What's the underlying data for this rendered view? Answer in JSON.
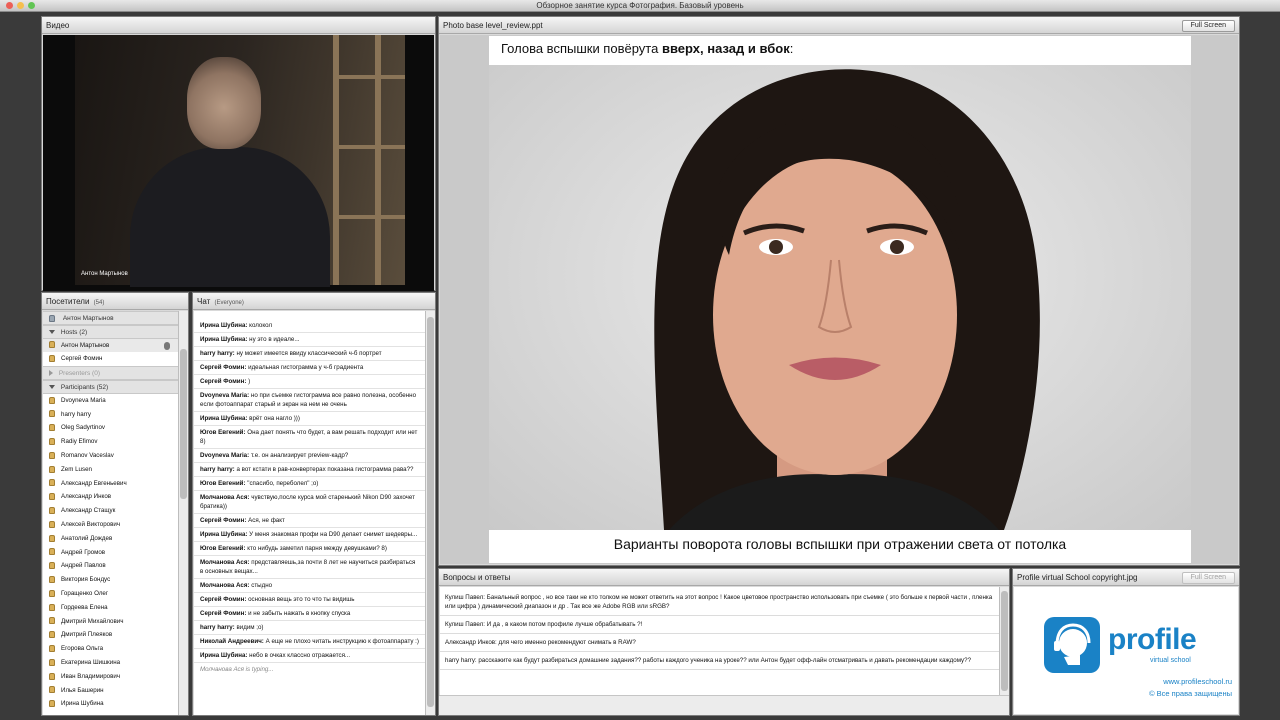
{
  "window": {
    "title": "Обзорное занятие курса Фотография. Базовый уровень"
  },
  "video": {
    "title": "Видео",
    "presenter_name": "Антон Мартынов"
  },
  "attendees": {
    "title": "Посетители",
    "count": "(54)",
    "top_user": "Антон Мартынов",
    "hosts_label": "Hosts (2)",
    "hosts": [
      "Антон Мартынов",
      "Сергей Фомин"
    ],
    "presenters_label": "Presenters (0)",
    "participants_label": "Participants (52)",
    "participants": [
      "Dvoyneva Maria",
      "harry harry",
      "Oleg Sadyrtinov",
      "Radiy Efimov",
      "Romanov Vaceslav",
      "Zem Lusen",
      "Александр Евгеньевич",
      "Александр Инков",
      "Александр Стащук",
      "Алексей Викторович",
      "Анатолий Дождев",
      "Андрей Громов",
      "Андрей Павлов",
      "Виктория Бондус",
      "Горащенко Олег",
      "Гордеева Елена",
      "Дмитрий Михайлович",
      "Дмитрий Плеяков",
      "Егорова Ольга",
      "Екатерина Шишкина",
      "Иван Владимирович",
      "Илья Башерин",
      "Ирина Шубина"
    ]
  },
  "chat": {
    "title": "Чат",
    "scope": "(Everyone)",
    "messages": [
      {
        "author": "Ирина Шубина:",
        "text": " колокол"
      },
      {
        "author": "Ирина Шубина:",
        "text": " ну это в идеале..."
      },
      {
        "author": "harry harry:",
        "text": " ну может имеется ввиду классический ч-б портрет"
      },
      {
        "author": "Сергей Фомин:",
        "text": " идеальная гистограмма у ч-б градиента"
      },
      {
        "author": "Сергей Фомин:",
        "text": " )"
      },
      {
        "author": "Dvoyneva Maria:",
        "text": " но при съемке гистограмма все равно полезна, особенно если фотоаппарат старый и экран на нем не очень"
      },
      {
        "author": "Ирина Шубина:",
        "text": " врёт она нагло )))"
      },
      {
        "author": "Югов Евгений:",
        "text": " Она дает понять что будет, а вам решать подходит или нет 8)"
      },
      {
        "author": "Dvoyneva Maria:",
        "text": " т.е. он анализирует preview-кадр?"
      },
      {
        "author": "harry harry:",
        "text": " а вот кстати в рав-конвертерах показана гистограмма рава??"
      },
      {
        "author": "Югов Евгений:",
        "text": " \"спасибо, переболел\" ;о)"
      },
      {
        "author": "Молчанова Ася:",
        "text": " чувствую,после курса мой старенький Nikon D90 захочет братика))"
      },
      {
        "author": "Сергей Фомин:",
        "text": " Ася, не факт"
      },
      {
        "author": "Ирина Шубина:",
        "text": " У меня знакомая профи на D90 делает снимет шедевры..."
      },
      {
        "author": "Югов Евгений:",
        "text": " кто нибудь заметил парня между девушками? 8)"
      },
      {
        "author": "Молчанова Ася:",
        "text": " представляешь,за почти 8 лет не научиться разбираться в основных вещах..."
      },
      {
        "author": "Молчанова Ася:",
        "text": " стыдно"
      },
      {
        "author": "Сергей Фомин:",
        "text": " основная вещь это то что ты видишь"
      },
      {
        "author": "Сергей Фомин:",
        "text": " и не забыть нажать в кнопку спуска"
      },
      {
        "author": "harry harry:",
        "text": " видим ;о)"
      },
      {
        "author": "Николай Андреевич:",
        "text": " А еще не плохо читать инструкцию к фотоаппарату :)"
      },
      {
        "author": "Ирина Шубина:",
        "text": " небо в очках классно отражается..."
      }
    ],
    "typing": "Молчанова Ася is typing..."
  },
  "slide": {
    "pod_title": "Photo base level_review.ppt",
    "fullscreen_label": "Full Screen",
    "top_text_normal": "Голова вспышки повёрута ",
    "top_text_bold": "вверх, назад и вбок",
    "top_text_end": ":",
    "bottom_text": "Варианты поворота головы вспышки при отражении света от потолка"
  },
  "qa": {
    "title": "Вопросы и ответы",
    "messages": [
      {
        "text": "Кулиш Павел: Банальный вопрос , но все таки не кто толком не может ответить на этот вопрос ! Какое цветовое пространство использовать при съемке ( это больше к первой части , пленка или цифра ) динамический диапазон и др . Так все же Adobe RGB или sRGB?"
      },
      {
        "text": "Кулиш Павел: И да , в каком потом профиле лучше обрабатывать ?!"
      },
      {
        "text": "Александр Инков: для чего именно рекомендуют снимать в RAW?"
      },
      {
        "text": "harry harry: расскажите как будут разбираться домашние задания?? работы каждого ученика на уроке?? или Антон будет офф-лайн отсматривать и давать рекомендации каждому??"
      }
    ]
  },
  "logo_pod": {
    "title": "Profile virtual School copyright.jpg",
    "fullscreen_label": "Full Screen",
    "brand": "profile",
    "brand_sub": "virtual school",
    "url": "www.profileschool.ru",
    "copyright": "© Все права защищены"
  },
  "colors": {
    "brand_blue": "#1a82c6"
  }
}
